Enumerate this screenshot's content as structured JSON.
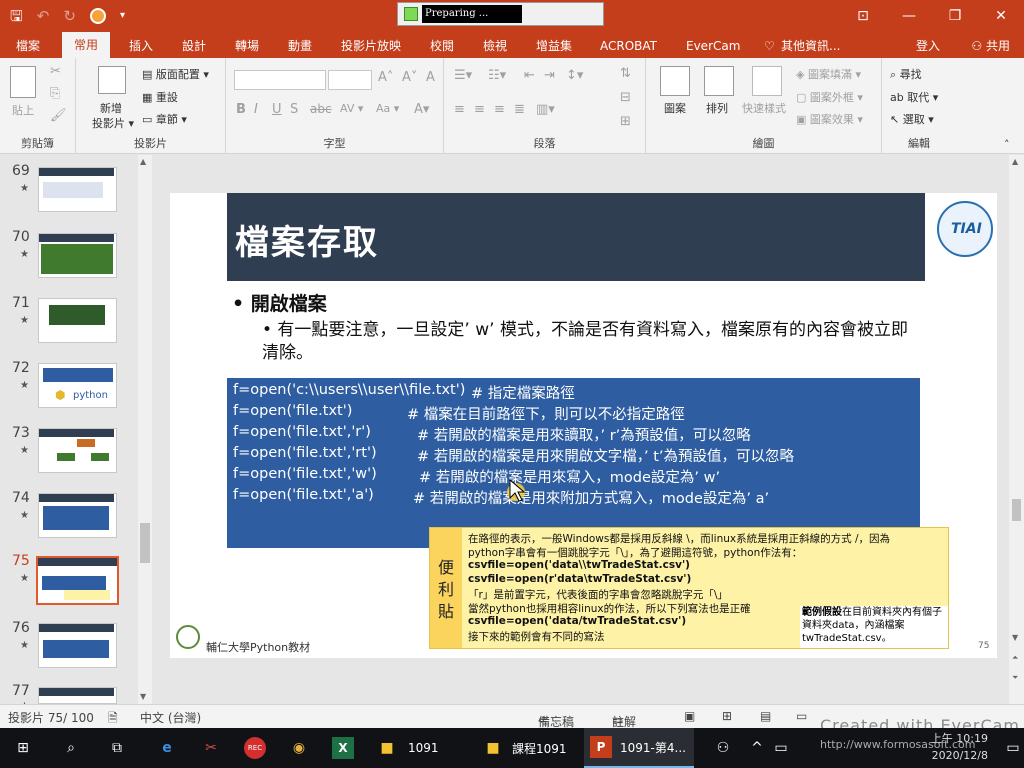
{
  "titlebar": {
    "preparing": "Preparing ...",
    "min": "—",
    "restore": "❐",
    "close": "✕",
    "ribbon_display": "⊡"
  },
  "tabs": [
    "檔案",
    "常用",
    "插入",
    "設計",
    "轉場",
    "動畫",
    "投影片放映",
    "校閱",
    "檢視",
    "增益集",
    "ACROBAT",
    "EverCam",
    "其他資訊..."
  ],
  "active_tab": "常用",
  "account": {
    "login": "登入",
    "share": "共用"
  },
  "ribbon": {
    "clipboard": {
      "label": "剪貼簿",
      "paste": "貼上"
    },
    "slides": {
      "label": "投影片",
      "new_slide": "新增",
      "new_slide2": "投影片 ▾",
      "layout": "版面配置 ▾",
      "reset": "重設",
      "section": "章節 ▾"
    },
    "font": {
      "label": "字型",
      "bold": "B",
      "italic": "I",
      "underline": "U",
      "strike": "S",
      "abc": "abc",
      "av": "AV ▾",
      "aa": "Aa ▾",
      "clear": "A"
    },
    "paragraph": {
      "label": "段落"
    },
    "drawing": {
      "label": "繪圖",
      "shapes": "圖案",
      "arrange": "排列",
      "quick_styles": "快速樣式",
      "fill": "圖案填滿 ▾",
      "outline": "圖案外框 ▾",
      "effects": "圖案效果 ▾"
    },
    "editing": {
      "label": "編輯",
      "find": "尋找",
      "replace": "取代 ▾",
      "select": "選取 ▾"
    }
  },
  "thumbnails": [
    {
      "num": "69",
      "star": "★"
    },
    {
      "num": "70",
      "star": "★"
    },
    {
      "num": "71",
      "star": "★"
    },
    {
      "num": "72",
      "star": "★"
    },
    {
      "num": "73",
      "star": "★"
    },
    {
      "num": "74",
      "star": "★"
    },
    {
      "num": "75",
      "star": "★"
    },
    {
      "num": "76",
      "star": "★"
    },
    {
      "num": "77",
      "star": "★"
    }
  ],
  "thumb_texts": {
    "t72": "python"
  },
  "slide": {
    "title": "檔案存取",
    "bullet1": "• 開啟檔案",
    "bullet2": "• 有一點要注意，一旦設定’ w’ 模式，不論是否有資料寫入，檔案原有的內容會被立即清除。",
    "code": [
      {
        "code": "f=open('c:\\\\users\\\\user\\\\file.txt')",
        "comment": "# 指定檔案路徑"
      },
      {
        "code": "f=open('file.txt')",
        "comment": "# 檔案在目前路徑下，則可以不必指定路徑"
      },
      {
        "code": "f=open('file.txt','r')",
        "comment": "# 若開啟的檔案是用來讀取，’ r’為預設值，可以忽略"
      },
      {
        "code": "f=open('file.txt','rt')",
        "comment": "# 若開啟的檔案是用來開啟文字檔，’ t’為預設值，可以忽略"
      },
      {
        "code": "f=open('file.txt','w')",
        "comment": "# 若開啟的檔案是用來寫入，mode設定為’ w’"
      },
      {
        "code": "f=open('file.txt','a')",
        "comment": "# 若開啟的檔案是用來附加方式寫入，mode設定為’ a’"
      }
    ],
    "note_side": [
      "便",
      "利",
      "貼"
    ],
    "note_lines": [
      "在路徑的表示，一般Windows都是採用反斜線 \\，而linux系統是採用正斜線的方式 /，因為",
      "python字串會有一個跳脫字元「\\」，為了避開這符號，python作法有：",
      "csvfile=open('data\\\\twTradeStat.csv')",
      "csvfile=open(r'data\\twTradeStat.csv')",
      "「r」是前置字元，代表後面的字串會忽略跳脫字元「\\」",
      "當然python也採用相容linux的作法，所以下列寫法也是正確",
      "csvfile=open('data/twTradeStat.csv')",
      "接下來的範例會有不同的寫法"
    ],
    "note_box_bold": "範例假設",
    "note_box_rest": "在目前資料夾內有個子資料夾data，內涵檔案twTradeStat.csv。",
    "footer": "輔仁大學Python教材",
    "page": "75",
    "logo_text": "TIAI"
  },
  "status": {
    "slide_info": "投影片 75/ 100",
    "language": "中文 (台灣)",
    "notes": "備忘稿",
    "comments": "註解"
  },
  "watermark": "Created with EverCam",
  "watermark2": "http://www.formosasoft.com",
  "taskbar": {
    "rec": "REC",
    "items": [
      "1091",
      "課程1091",
      "1091-第4..."
    ],
    "time": "上午 10:19",
    "date": "2020/12/8"
  }
}
